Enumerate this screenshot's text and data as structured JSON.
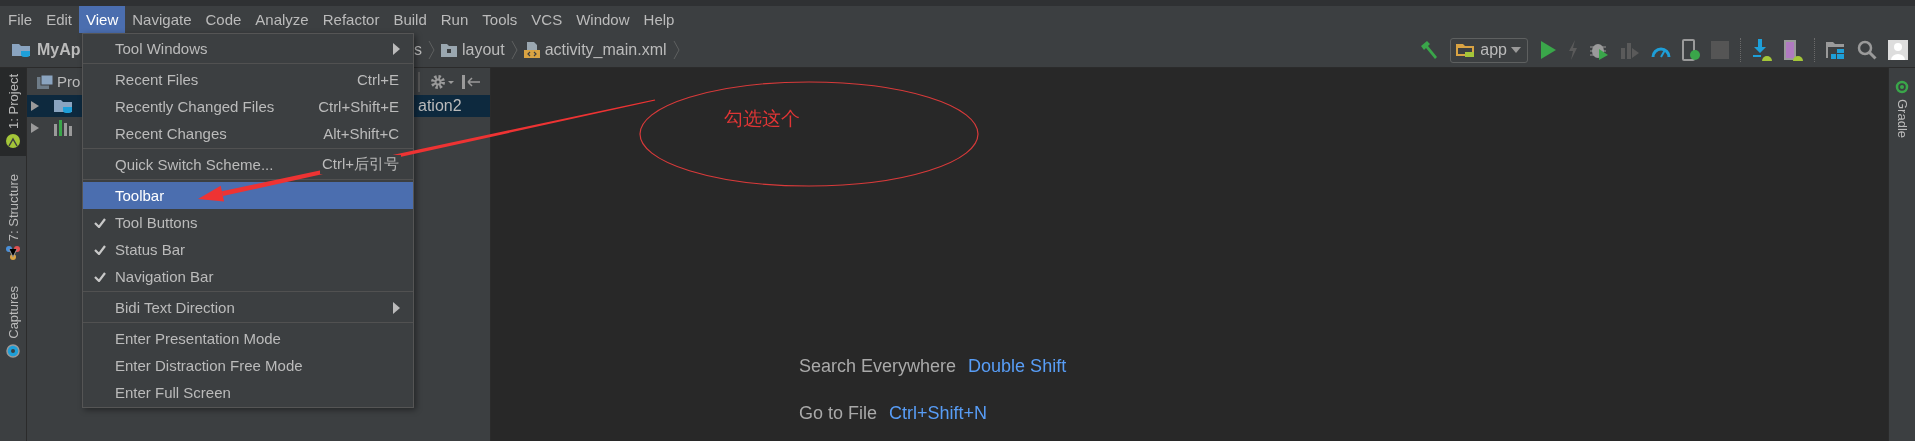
{
  "menu_bar": [
    {
      "label": "File",
      "selected": false
    },
    {
      "label": "Edit",
      "selected": false
    },
    {
      "label": "View",
      "selected": true
    },
    {
      "label": "Navigate",
      "selected": false
    },
    {
      "label": "Code",
      "selected": false
    },
    {
      "label": "Analyze",
      "selected": false
    },
    {
      "label": "Refactor",
      "selected": false
    },
    {
      "label": "Build",
      "selected": false
    },
    {
      "label": "Run",
      "selected": false
    },
    {
      "label": "Tools",
      "selected": false
    },
    {
      "label": "VCS",
      "selected": false
    },
    {
      "label": "Window",
      "selected": false
    },
    {
      "label": "Help",
      "selected": false
    }
  ],
  "navigation_bar": {
    "crumbs": [
      {
        "label": "MyAp",
        "kind": "module"
      },
      {
        "label": "s",
        "kind": "text"
      },
      {
        "label": "layout",
        "kind": "folder"
      },
      {
        "label": "activity_main.xml",
        "kind": "file"
      }
    ],
    "run_configuration": "app"
  },
  "left_tool_windows": [
    {
      "label": "1: Project",
      "selected": true,
      "kind": "android"
    },
    {
      "label": "7: Structure",
      "selected": false,
      "kind": "structure"
    },
    {
      "label": "Captures",
      "selected": false,
      "kind": "captures"
    }
  ],
  "project_panel": {
    "title": "Pro",
    "rows": [
      {
        "label": "ation2",
        "selected": true,
        "expanded": false,
        "kind": "module"
      },
      {
        "selected": false,
        "expanded": false,
        "kind": "libraries"
      }
    ]
  },
  "editor_hints": [
    {
      "action": "Search Everywhere",
      "shortcut": "Double Shift"
    },
    {
      "action": "Go to File",
      "shortcut": "Ctrl+Shift+N"
    }
  ],
  "right_tool_windows": [
    {
      "label": "Gradle",
      "selected": false
    }
  ],
  "view_menu": {
    "groups": [
      [
        {
          "label": "Tool Windows",
          "submenu": true,
          "checked": false,
          "selected": false
        }
      ],
      [
        {
          "label": "Recent Files",
          "shortcut": "Ctrl+E",
          "submenu": false,
          "checked": false,
          "selected": false
        },
        {
          "label": "Recently Changed Files",
          "shortcut": "Ctrl+Shift+E",
          "submenu": false,
          "checked": false,
          "selected": false
        },
        {
          "label": "Recent Changes",
          "shortcut": "Alt+Shift+C",
          "submenu": false,
          "checked": false,
          "selected": false
        }
      ],
      [
        {
          "label": "Quick Switch Scheme...",
          "shortcut": "Ctrl+后引号",
          "submenu": false,
          "checked": false,
          "selected": false
        }
      ],
      [
        {
          "label": "Toolbar",
          "submenu": false,
          "checked": false,
          "selected": true
        },
        {
          "label": "Tool Buttons",
          "submenu": false,
          "checked": true,
          "selected": false
        },
        {
          "label": "Status Bar",
          "submenu": false,
          "checked": true,
          "selected": false
        },
        {
          "label": "Navigation Bar",
          "submenu": false,
          "checked": true,
          "selected": false
        }
      ],
      [
        {
          "label": "Bidi Text Direction",
          "submenu": true,
          "checked": false,
          "selected": false
        }
      ],
      [
        {
          "label": "Enter Presentation Mode",
          "submenu": false,
          "checked": false,
          "selected": false
        },
        {
          "label": "Enter Distraction Free Mode",
          "submenu": false,
          "checked": false,
          "selected": false
        },
        {
          "label": "Enter Full Screen",
          "submenu": false,
          "checked": false,
          "selected": false
        }
      ]
    ]
  },
  "annotation": {
    "text": "勾选这个"
  }
}
